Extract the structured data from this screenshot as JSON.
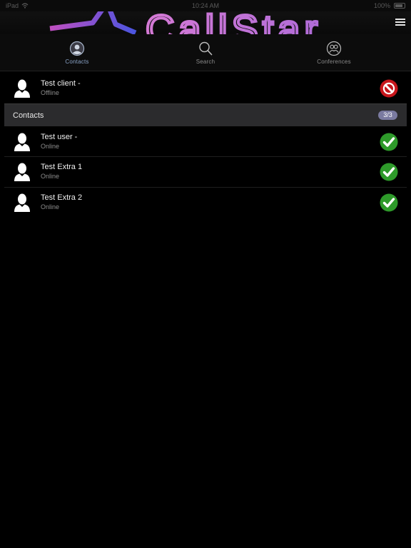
{
  "status_bar": {
    "carrier": "iPad",
    "time": "10:24 AM",
    "battery": "100%"
  },
  "header": {
    "logo_text": "CallStar",
    "menu_icon": "hamburger-menu-icon"
  },
  "tabs": [
    {
      "label": "Contacts",
      "icon": "contacts-avatar-icon",
      "active": true
    },
    {
      "label": "Search",
      "icon": "search-icon",
      "active": false
    },
    {
      "label": "Conferences",
      "icon": "conferences-icon",
      "active": false
    }
  ],
  "self": {
    "name": "Test client -",
    "status": "Offline",
    "status_icon": "offline-block-icon"
  },
  "group": {
    "title": "Contacts",
    "count": "3/3"
  },
  "contacts": [
    {
      "name": "Test user -",
      "status": "Online",
      "status_icon": "online-check-icon"
    },
    {
      "name": "Test Extra 1",
      "status": "Online",
      "status_icon": "online-check-icon"
    },
    {
      "name": "Test Extra 2",
      "status": "Online",
      "status_icon": "online-check-icon"
    }
  ],
  "colors": {
    "background": "#000000",
    "online": "#2e9a2a",
    "offline": "#c8161c",
    "group_header": "#2b2b2d",
    "count_badge": "#7a7aa0",
    "logo_pink": "#c86ec8",
    "logo_blue": "#4a5ad8"
  }
}
